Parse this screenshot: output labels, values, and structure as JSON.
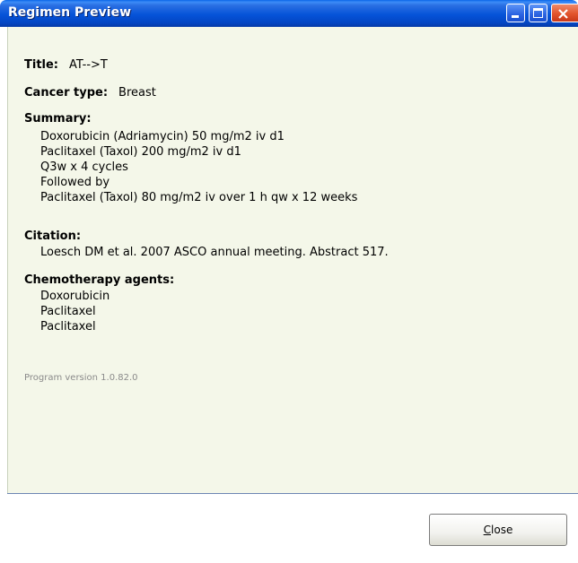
{
  "window": {
    "title": "Regimen Preview"
  },
  "details": {
    "title_label": "Title:",
    "title_value": "AT-->T",
    "cancer_label": "Cancer type:",
    "cancer_value": "Breast",
    "summary_label": "Summary:",
    "summary_lines": [
      "Doxorubicin (Adriamycin) 50 mg/m2 iv d1",
      "Paclitaxel (Taxol) 200 mg/m2 iv d1",
      "Q3w x 4 cycles",
      "Followed by",
      "Paclitaxel (Taxol) 80 mg/m2 iv over 1 h qw x 12 weeks"
    ],
    "citation_label": "Citation:",
    "citation_text": "Loesch DM et al. 2007 ASCO annual meeting. Abstract 517.",
    "agents_label": "Chemotherapy agents:",
    "agents": [
      "Doxorubicin",
      "Paclitaxel",
      "Paclitaxel"
    ],
    "version_text": "Program version 1.0.82.0"
  },
  "buttons": {
    "close_accel": "C",
    "close_rest": "lose"
  },
  "colors": {
    "titlebar": "#0553d8",
    "content_bg": "#f4f7e9",
    "close_button_red": "#e2542c"
  }
}
